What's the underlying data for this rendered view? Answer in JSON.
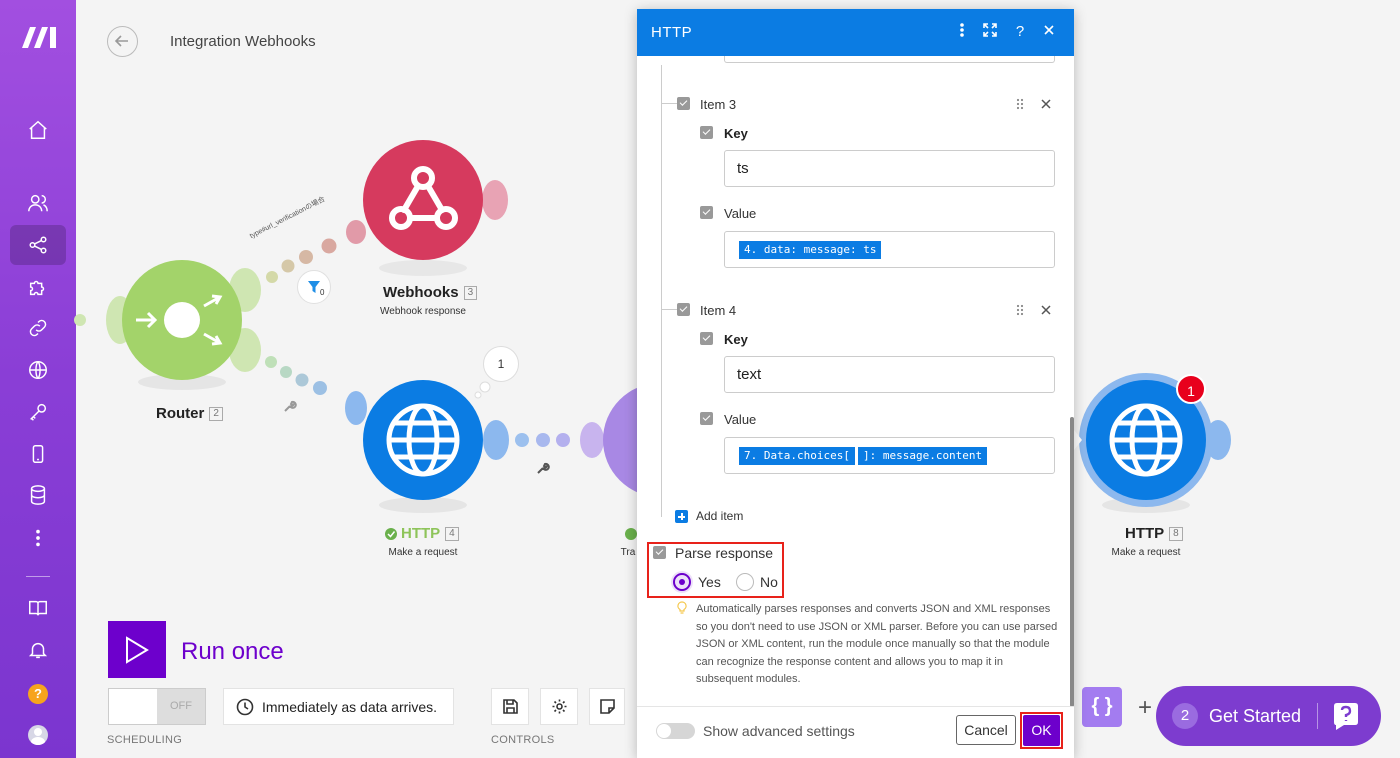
{
  "header": {
    "title": "Integration Webhooks"
  },
  "nodes": {
    "router": {
      "label": "Router",
      "index": "2"
    },
    "webhooks": {
      "label": "Webhooks",
      "index": "3",
      "subtitle": "Webhook response"
    },
    "http4": {
      "label": "HTTP",
      "index": "4",
      "subtitle": "Make a request"
    },
    "partial": {
      "subtitle": "Tra"
    },
    "http8": {
      "label": "HTTP",
      "index": "8",
      "subtitle": "Make a request",
      "badge": "1"
    },
    "bubble": "1",
    "route_label": "type#url_verificationの場合",
    "filter_count": "0"
  },
  "controls": {
    "run_label": "Run once",
    "toggle_state": "OFF",
    "schedule_text": "Immediately as data arrives.",
    "scheduling_caption": "SCHEDULING",
    "controls_caption": "CONTROLS",
    "braces": "{ }",
    "plus": "+"
  },
  "get_started": {
    "count": "2",
    "label": "Get Started"
  },
  "dialog": {
    "title": "HTTP",
    "items": [
      {
        "label": "Item 3",
        "key_label": "Key",
        "key_value": "ts",
        "value_label": "Value",
        "value_pills": [
          "4. data: message: ts"
        ]
      },
      {
        "label": "Item 4",
        "key_label": "Key",
        "key_value": "text",
        "value_label": "Value",
        "value_pills": [
          "7. Data.choices[",
          "]: message.content"
        ]
      }
    ],
    "add_item": "Add item",
    "parse_response": {
      "label": "Parse response",
      "yes": "Yes",
      "no": "No",
      "selected": "Yes"
    },
    "help": "Automatically parses responses and converts JSON and XML responses so you don't need to use JSON or XML parser. Before you can use parsed JSON or XML content, run the module once manually so that the module can recognize the response content and allows you to map it in subsequent modules.",
    "advanced": "Show advanced settings",
    "cancel": "Cancel",
    "ok": "OK"
  },
  "colors": {
    "sidebar": "#8a3ed6",
    "dialog_header": "#0b7ce3",
    "accent": "#6d00cc",
    "router": "#a3d36a",
    "webhooks": "#d63a5e",
    "http": "#0b7ce3",
    "highlight": "#e8221a"
  }
}
